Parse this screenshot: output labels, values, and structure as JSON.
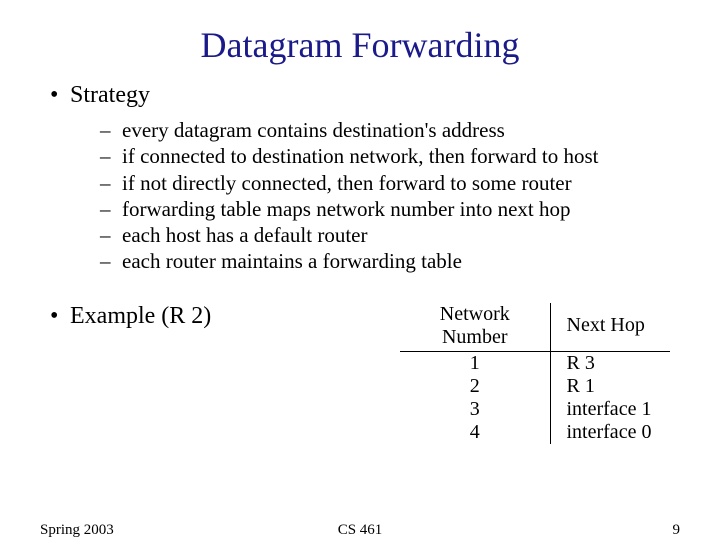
{
  "title": "Datagram Forwarding",
  "b1": {
    "label": "Strategy"
  },
  "sub": {
    "s0": "every datagram contains destination's address",
    "s1": "if connected to destination network, then forward to host",
    "s2": "if not directly connected, then forward to some router",
    "s3": "forwarding table maps network number into next hop",
    "s4": "each host has a default router",
    "s5": "each router maintains a forwarding table"
  },
  "b2": {
    "label": "Example (R 2)"
  },
  "table": {
    "h1": "Network Number",
    "h2": "Next Hop",
    "rows": {
      "r0": {
        "a": "1",
        "b": "R 3"
      },
      "r1": {
        "a": "2",
        "b": "R 1"
      },
      "r2": {
        "a": "3",
        "b": "interface 1"
      },
      "r3": {
        "a": "4",
        "b": "interface 0"
      }
    }
  },
  "footer": {
    "left": "Spring 2003",
    "center": "CS 461",
    "right": "9"
  },
  "chart_data": {
    "type": "table",
    "title": "Forwarding table for R2",
    "columns": [
      "Network Number",
      "Next Hop"
    ],
    "rows": [
      [
        1,
        "R 3"
      ],
      [
        2,
        "R 1"
      ],
      [
        3,
        "interface 1"
      ],
      [
        4,
        "interface 0"
      ]
    ]
  }
}
